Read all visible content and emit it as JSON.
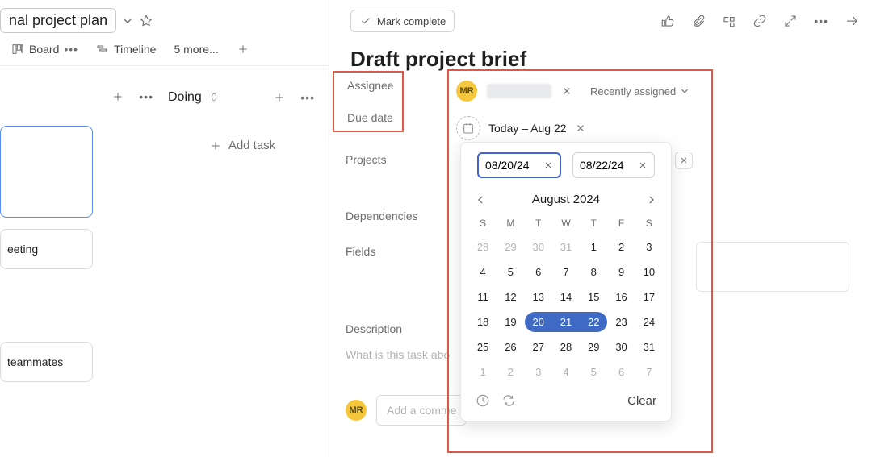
{
  "project": {
    "title_visible": "nal project plan"
  },
  "views": {
    "board": "Board",
    "timeline": "Timeline",
    "more": "5 more..."
  },
  "columns": {
    "doing": "Doing",
    "doing_count": "0",
    "add_task": "Add task",
    "card_meeting": "eeting",
    "card_teammates": "teammates"
  },
  "pane": {
    "mark_complete": "Mark complete",
    "task_title": "Draft project brief",
    "labels": {
      "assignee": "Assignee",
      "due_date": "Due date",
      "projects": "Projects",
      "dependencies": "Dependencies",
      "fields": "Fields",
      "description": "Description"
    },
    "assignee_initials": "MR",
    "recently_assigned": "Recently assigned",
    "date_range_text": "Today – Aug 22",
    "description_placeholder": "What is this task abo",
    "comment_placeholder": "Add a comme"
  },
  "datepicker": {
    "start": "08/20/24",
    "end": "08/22/24",
    "month_label": "August 2024",
    "dow": [
      "S",
      "M",
      "T",
      "W",
      "T",
      "F",
      "S"
    ],
    "weeks": [
      [
        {
          "d": "28",
          "o": true
        },
        {
          "d": "29",
          "o": true
        },
        {
          "d": "30",
          "o": true
        },
        {
          "d": "31",
          "o": true
        },
        {
          "d": "1"
        },
        {
          "d": "2"
        },
        {
          "d": "3"
        }
      ],
      [
        {
          "d": "4"
        },
        {
          "d": "5"
        },
        {
          "d": "6"
        },
        {
          "d": "7"
        },
        {
          "d": "8"
        },
        {
          "d": "9"
        },
        {
          "d": "10"
        }
      ],
      [
        {
          "d": "11"
        },
        {
          "d": "12"
        },
        {
          "d": "13"
        },
        {
          "d": "14"
        },
        {
          "d": "15"
        },
        {
          "d": "16"
        },
        {
          "d": "17"
        }
      ],
      [
        {
          "d": "18"
        },
        {
          "d": "19"
        },
        {
          "d": "20",
          "sel": "start"
        },
        {
          "d": "21",
          "sel": "mid"
        },
        {
          "d": "22",
          "sel": "end"
        },
        {
          "d": "23"
        },
        {
          "d": "24"
        }
      ],
      [
        {
          "d": "25"
        },
        {
          "d": "26"
        },
        {
          "d": "27"
        },
        {
          "d": "28"
        },
        {
          "d": "29"
        },
        {
          "d": "30"
        },
        {
          "d": "31"
        }
      ],
      [
        {
          "d": "1",
          "o": true
        },
        {
          "d": "2",
          "o": true
        },
        {
          "d": "3",
          "o": true
        },
        {
          "d": "4",
          "o": true
        },
        {
          "d": "5",
          "o": true
        },
        {
          "d": "6",
          "o": true
        },
        {
          "d": "7",
          "o": true
        }
      ]
    ],
    "clear": "Clear"
  }
}
